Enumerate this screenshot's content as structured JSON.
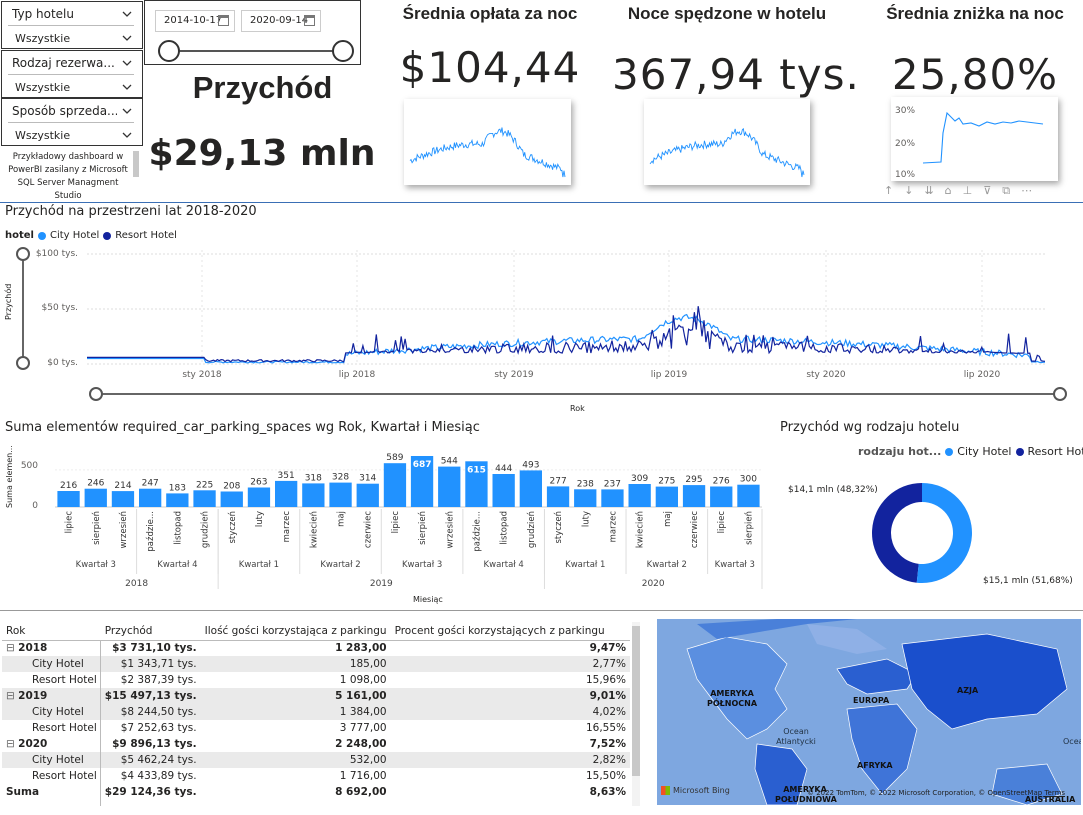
{
  "slicers": [
    {
      "title": "Typ hotelu",
      "value": "Wszystkie"
    },
    {
      "title": "Rodzaj rezerwa...",
      "value": "Wszystkie"
    },
    {
      "title": "Sposób sprzeda...",
      "value": "Wszystkie"
    }
  ],
  "date_range": {
    "start": "2014-10-17",
    "end": "2020-09-14"
  },
  "revenue": {
    "title": "Przychód",
    "value": "$29,13 mln"
  },
  "note": [
    "Przykładowy dashboard w",
    "PowerBI zasilany z Microsoft",
    "SQL Server Managment Studio"
  ],
  "kpis": [
    {
      "title": "Średnia opłata za noc",
      "value": "$104,44"
    },
    {
      "title": "Noce spędzone w hotelu",
      "value": "367,94 tys."
    },
    {
      "title": "Średnia zniżka na noc",
      "value": "25,80%",
      "ticks": [
        "30%",
        "20%",
        "10%"
      ]
    }
  ],
  "line_chart": {
    "title": "Przychód na przestrzeni lat 2018-2020",
    "legend_title": "hotel",
    "series_names": [
      "City Hotel",
      "Resort Hotel"
    ],
    "y_ticks": [
      "$100 tys.",
      "$50 tys.",
      "$0 tys."
    ],
    "ylabel": "Przychód",
    "x_ticks": [
      "sty 2018",
      "lip 2018",
      "sty 2019",
      "lip 2019",
      "sty 2020",
      "lip 2020"
    ],
    "xlabel": "Rok"
  },
  "colors": {
    "city": "#2192ff",
    "resort": "#12239e",
    "bar": "#2192ff"
  },
  "chart_data": {
    "type": "bar",
    "title": "Suma elementów required_car_parking_spaces wg Rok, Kwartał i Miesiąc",
    "ylabel": "Suma elemen...",
    "xlabel": "Miesiąc",
    "ylim": [
      0,
      700
    ],
    "y_ticks": [
      "500",
      "0"
    ],
    "categories": [
      "lipiec",
      "sierpień",
      "wrzesień",
      "paździe...",
      "listopad",
      "grudzień",
      "styczeń",
      "luty",
      "marzec",
      "kwiecień",
      "maj",
      "czerwiec",
      "lipiec",
      "sierpień",
      "wrzesień",
      "paździe...",
      "listopad",
      "grudzień",
      "styczeń",
      "luty",
      "marzec",
      "kwiecień",
      "maj",
      "czerwiec",
      "lipiec",
      "sierpień"
    ],
    "values": [
      216,
      246,
      214,
      247,
      183,
      225,
      208,
      263,
      351,
      318,
      328,
      314,
      589,
      687,
      544,
      615,
      444,
      493,
      277,
      238,
      237,
      309,
      275,
      295,
      276,
      300
    ],
    "quarters": [
      {
        "label": "Kwartał 3",
        "start": 0,
        "end": 2
      },
      {
        "label": "Kwartał 4",
        "start": 3,
        "end": 5
      },
      {
        "label": "Kwartał 1",
        "start": 6,
        "end": 8
      },
      {
        "label": "Kwartał 2",
        "start": 9,
        "end": 11
      },
      {
        "label": "Kwartał 3",
        "start": 12,
        "end": 14
      },
      {
        "label": "Kwartał 4",
        "start": 15,
        "end": 17
      },
      {
        "label": "Kwartał 1",
        "start": 18,
        "end": 20
      },
      {
        "label": "Kwartał 2",
        "start": 21,
        "end": 23
      },
      {
        "label": "Kwartał 3",
        "start": 24,
        "end": 25
      }
    ],
    "years": [
      {
        "label": "2018",
        "start": 0,
        "end": 5
      },
      {
        "label": "2019",
        "start": 6,
        "end": 17
      },
      {
        "label": "2020",
        "start": 18,
        "end": 25
      }
    ]
  },
  "donut": {
    "title": "Przychód wg rodzaju hotelu",
    "legend_title": "rodzaju hot...",
    "names": [
      "City Hotel",
      "Resort Hotel"
    ],
    "shares": [
      51.68,
      48.32
    ],
    "labels": [
      "$15,1 mln (51,68%)",
      "$14,1 mln (48,32%)"
    ]
  },
  "table": {
    "headers": [
      "Rok",
      "Przychód",
      "Ilość gości korzystająca z parkingu",
      "Procent gości korzystających z parkingu"
    ],
    "rows": [
      {
        "kind": "year",
        "label": "2018",
        "rev": "$3 731,10 tys.",
        "guests": "1 283,00",
        "pct": "9,47%"
      },
      {
        "kind": "sub",
        "label": "City Hotel",
        "rev": "$1 343,71 tys.",
        "guests": "185,00",
        "pct": "2,77%"
      },
      {
        "kind": "sub",
        "label": "Resort Hotel",
        "rev": "$2 387,39 tys.",
        "guests": "1 098,00",
        "pct": "15,96%"
      },
      {
        "kind": "year",
        "label": "2019",
        "rev": "$15 497,13 tys.",
        "guests": "5 161,00",
        "pct": "9,01%"
      },
      {
        "kind": "sub",
        "label": "City Hotel",
        "rev": "$8 244,50 tys.",
        "guests": "1 384,00",
        "pct": "4,02%"
      },
      {
        "kind": "sub",
        "label": "Resort Hotel",
        "rev": "$7 252,63 tys.",
        "guests": "3 777,00",
        "pct": "16,55%"
      },
      {
        "kind": "year",
        "label": "2020",
        "rev": "$9 896,13 tys.",
        "guests": "2 248,00",
        "pct": "7,52%"
      },
      {
        "kind": "sub",
        "label": "City Hotel",
        "rev": "$5 462,24 tys.",
        "guests": "532,00",
        "pct": "2,82%"
      },
      {
        "kind": "sub",
        "label": "Resort Hotel",
        "rev": "$4 433,89 tys.",
        "guests": "1 716,00",
        "pct": "15,50%"
      },
      {
        "kind": "total",
        "label": "Suma",
        "rev": "$29 124,36 tys.",
        "guests": "8 692,00",
        "pct": "8,63%"
      }
    ]
  },
  "map": {
    "labels": [
      "AMERYKA PÓŁNOCNA",
      "EUROPA",
      "AZJA",
      "AFRYKA",
      "AMERYKA POŁUDNIOWA",
      "AUSTRALIA",
      "Ocean Atlantycki",
      "Ocean"
    ],
    "brand": "Microsoft Bing",
    "credit": "© 2022 TomTom, © 2022 Microsoft Corporation, © OpenStreetMap",
    "terms": "Terms"
  }
}
